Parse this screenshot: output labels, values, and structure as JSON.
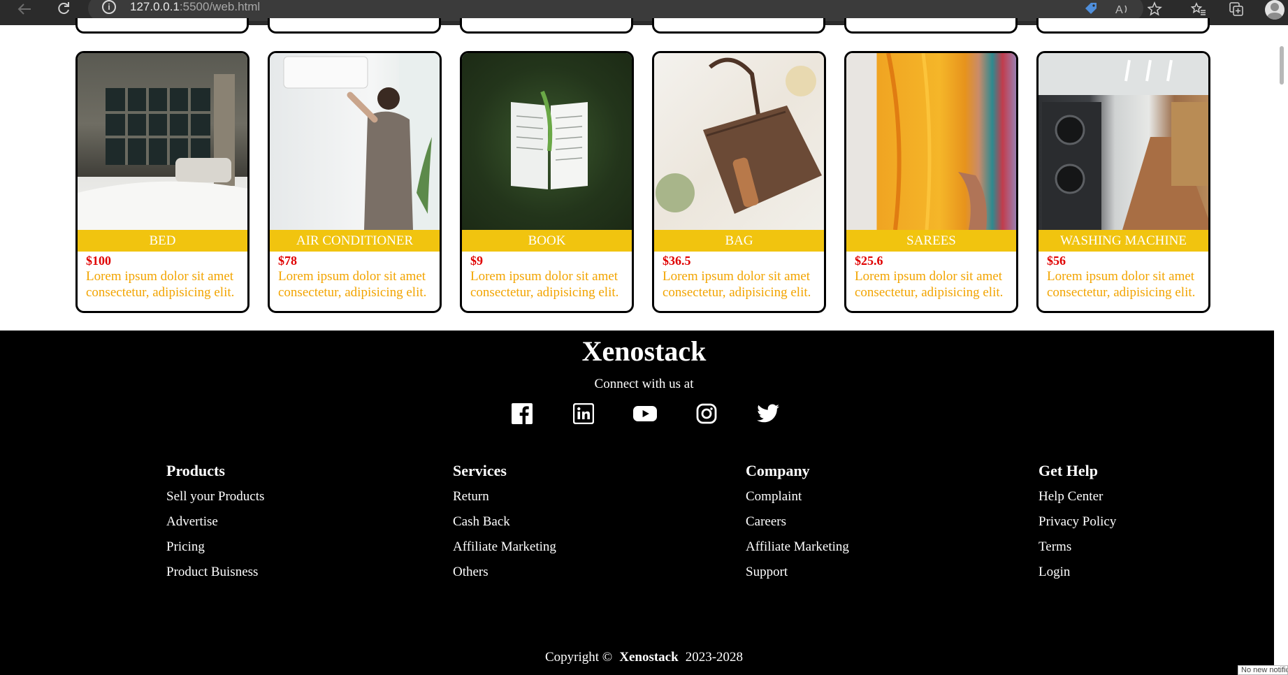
{
  "browser": {
    "url_host": "127.0.0.1",
    "url_rest": ":5500/web.html",
    "icons": [
      "back-arrow-icon",
      "reload-icon",
      "info-icon",
      "tag-icon",
      "read-aloud-icon",
      "add-favorite-icon",
      "favorites-icon",
      "collections-icon",
      "profile-icon"
    ]
  },
  "products": [
    {
      "name": "BED",
      "price": "$100",
      "desc": "Lorem ipsum dolor sit amet consectetur, adipisicing elit."
    },
    {
      "name": "AIR CONDITIONER",
      "price": "$78",
      "desc": "Lorem ipsum dolor sit amet consectetur, adipisicing elit."
    },
    {
      "name": "BOOK",
      "price": "$9",
      "desc": "Lorem ipsum dolor sit amet consectetur, adipisicing elit."
    },
    {
      "name": "BAG",
      "price": "$36.5",
      "desc": "Lorem ipsum dolor sit amet consectetur, adipisicing elit."
    },
    {
      "name": "SAREES",
      "price": "$25.6",
      "desc": "Lorem ipsum dolor sit amet consectetur, adipisicing elit."
    },
    {
      "name": "WASHING MACHINE",
      "price": "$56",
      "desc": "Lorem ipsum dolor sit amet consectetur, adipisicing elit."
    }
  ],
  "footer": {
    "brand": "Xenostack",
    "connect": "Connect with us at",
    "social": [
      "facebook-icon",
      "linkedin-icon",
      "youtube-icon",
      "instagram-icon",
      "twitter-icon"
    ],
    "columns": [
      {
        "title": "Products",
        "links": [
          "Sell your Products",
          "Advertise",
          "Pricing",
          "Product Buisness"
        ]
      },
      {
        "title": "Services",
        "links": [
          "Return",
          "Cash Back",
          "Affiliate Marketing",
          "Others"
        ]
      },
      {
        "title": "Company",
        "links": [
          "Complaint",
          "Careers",
          "Affiliate Marketing",
          "Support"
        ]
      },
      {
        "title": "Get Help",
        "links": [
          "Help Center",
          "Privacy Policy",
          "Terms",
          "Login"
        ]
      }
    ],
    "copyright_prefix": "Copyright ©",
    "copyright_brand": "Xenostack",
    "copyright_years": "2023-2028"
  },
  "toast": "No new notifications"
}
